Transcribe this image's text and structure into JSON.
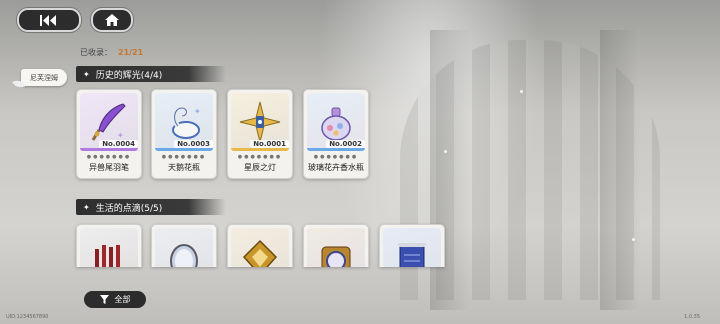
{
  "collection": {
    "label": "已收录：",
    "count": "21/21"
  },
  "character_tab": {
    "label": "尼芙涅姆"
  },
  "sections": [
    {
      "title": "历史的辉光(4/4)",
      "items": [
        {
          "name": "异兽尾羽笔",
          "number": "No.0004",
          "icon": "quill-pen-icon",
          "band_color": "#b07be0"
        },
        {
          "name": "天鹅花瓶",
          "number": "No.0003",
          "icon": "swan-vase-icon",
          "band_color": "#6aa8e6"
        },
        {
          "name": "星辰之灯",
          "number": "No.0001",
          "icon": "star-lamp-icon",
          "band_color": "#e6b94a"
        },
        {
          "name": "玻璃花卉香水瓶",
          "number": "No.0002",
          "icon": "perfume-bottle-icon",
          "band_color": "#6aa8e6"
        }
      ]
    },
    {
      "title": "生活的点滴(5/5)",
      "items": [
        {
          "icon": "crown-candles-icon"
        },
        {
          "icon": "mirror-icon"
        },
        {
          "icon": "golden-frame-icon"
        },
        {
          "icon": "ornate-clock-icon"
        },
        {
          "icon": "scroll-icon"
        }
      ]
    }
  ],
  "filter": {
    "label": "全部",
    "icon": "filter-icon"
  },
  "footer": {
    "uid": "UID:1234567890",
    "version": "1.0.35"
  },
  "colors": {
    "accent": "#c8762c",
    "dark_button": "#2c2c2c"
  }
}
